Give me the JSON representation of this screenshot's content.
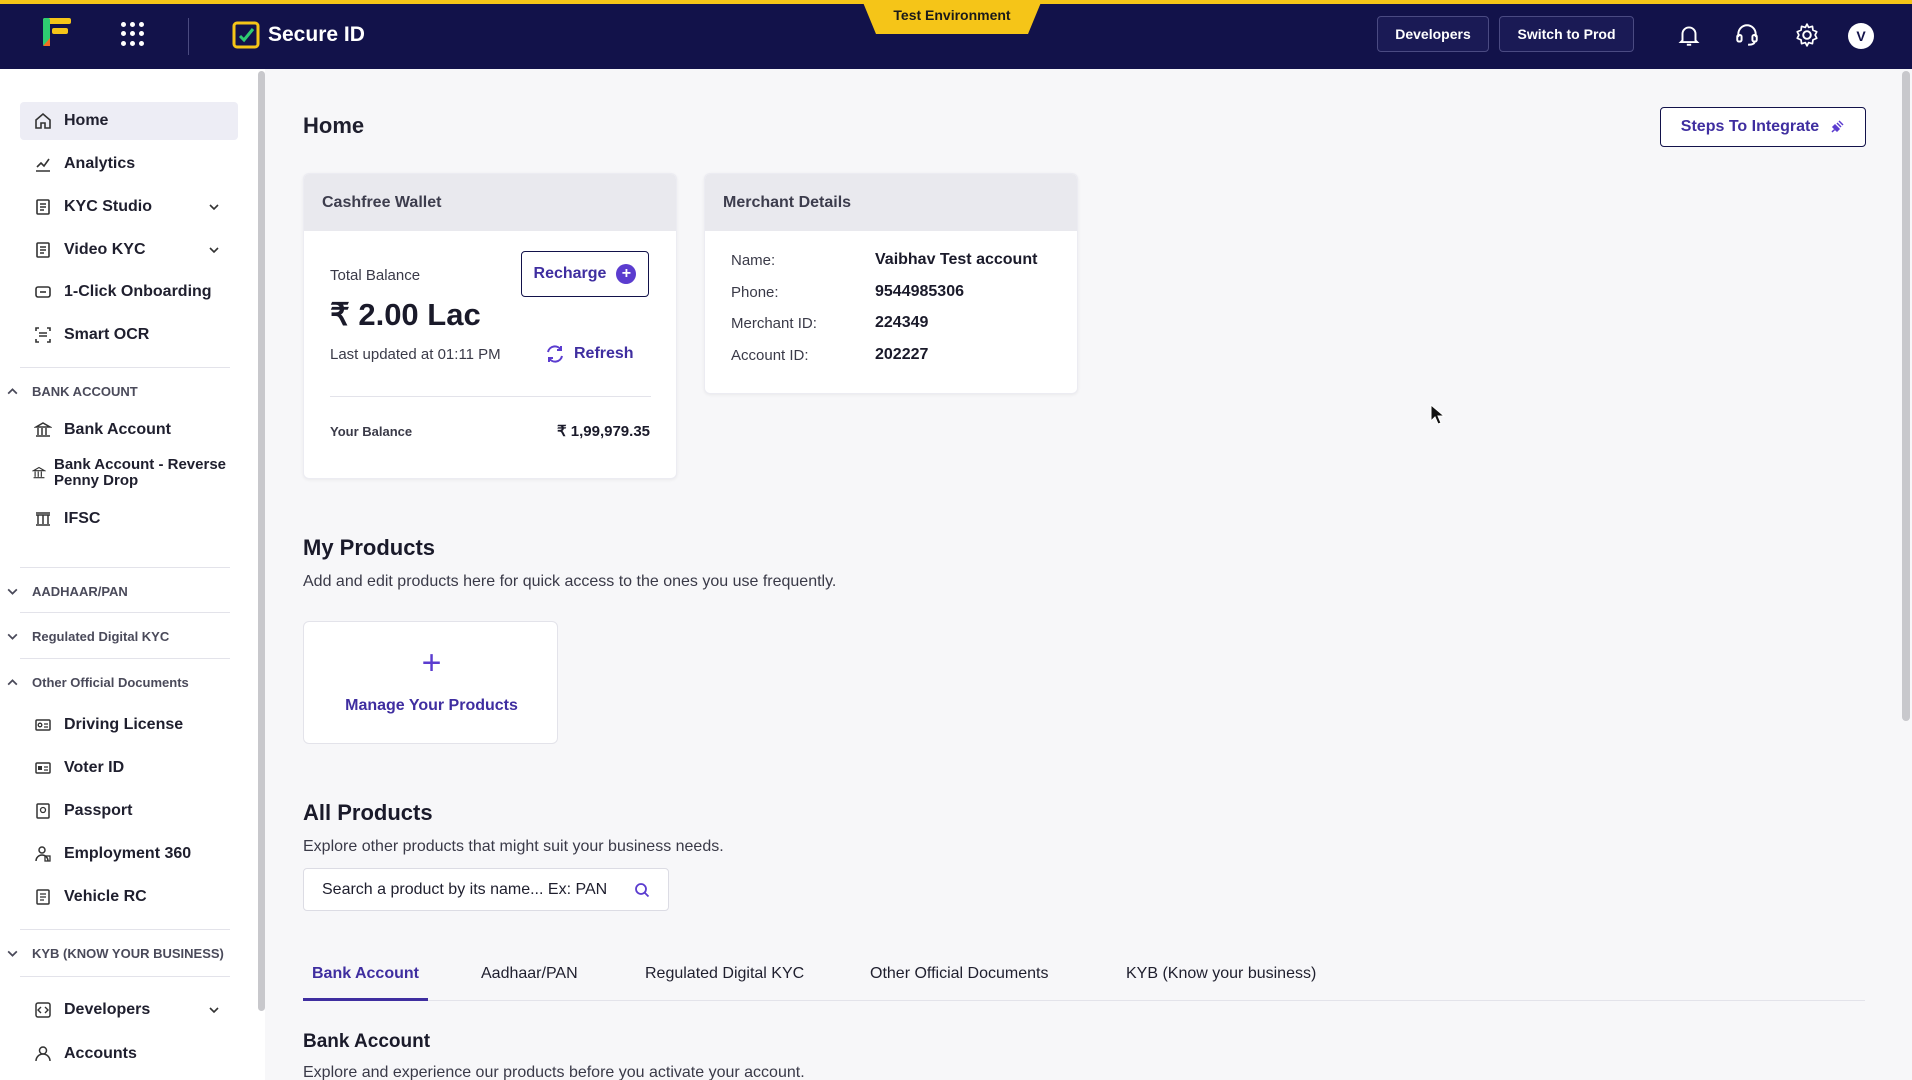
{
  "topbar": {
    "brand": "Secure ID",
    "environment": "Test Environment",
    "developers_label": "Developers",
    "switch_label": "Switch to Prod",
    "avatar_initial": "V",
    "colors": {
      "background": "#12124a",
      "accent": "#f5c518"
    }
  },
  "sidebar": {
    "items": [
      {
        "label": "Home",
        "icon": "home-icon",
        "active": true
      },
      {
        "label": "Analytics",
        "icon": "analytics-icon"
      },
      {
        "label": "KYC Studio",
        "icon": "kyc-studio-icon",
        "expandable": true
      },
      {
        "label": "Video KYC",
        "icon": "video-kyc-icon",
        "expandable": true
      },
      {
        "label": "1-Click Onboarding",
        "icon": "onboarding-icon"
      },
      {
        "label": "Smart OCR",
        "icon": "ocr-icon"
      }
    ],
    "sections": {
      "bank_account": {
        "title": "BANK ACCOUNT",
        "items": [
          "Bank Account",
          "Bank Account - Reverse Penny Drop",
          "IFSC"
        ]
      },
      "aadhaar_pan": {
        "title": "AADHAAR/PAN"
      },
      "regulated_kyc": {
        "title": "Regulated Digital KYC"
      },
      "other_docs": {
        "title": "Other Official Documents",
        "items": [
          "Driving License",
          "Voter ID",
          "Passport",
          "Employment 360",
          "Vehicle RC"
        ]
      },
      "kyb": {
        "title": "KYB (KNOW YOUR BUSINESS)"
      }
    },
    "bottom": [
      {
        "label": "Developers",
        "expandable": true
      },
      {
        "label": "Accounts"
      }
    ]
  },
  "main": {
    "title": "Home",
    "steps_label": "Steps To Integrate",
    "wallet": {
      "title": "Cashfree Wallet",
      "total_label": "Total Balance",
      "total_amount": "₹ 2.00 Lac",
      "recharge_label": "Recharge",
      "updated_text": "Last updated at 01:11 PM",
      "refresh_label": "Refresh",
      "your_balance_label": "Your Balance",
      "your_balance_value": "₹ 1,99,979.35"
    },
    "merchant": {
      "title": "Merchant Details",
      "rows": [
        {
          "label": "Name:",
          "value": "Vaibhav Test account"
        },
        {
          "label": "Phone:",
          "value": "9544985306"
        },
        {
          "label": "Merchant ID:",
          "value": "224349"
        },
        {
          "label": "Account ID:",
          "value": "202227"
        }
      ]
    },
    "my_products": {
      "title": "My Products",
      "subtitle": "Add and edit products here for quick access to the ones you use frequently.",
      "manage_label": "Manage Your Products"
    },
    "all_products": {
      "title": "All Products",
      "subtitle": "Explore other products that might suit your business needs.",
      "search_placeholder": "Search a product by its name... Ex: PAN",
      "tabs": [
        "Bank Account",
        "Aadhaar/PAN",
        "Regulated Digital KYC",
        "Other Official Documents",
        "KYB (Know your business)"
      ],
      "active_tab": "Bank Account",
      "section_title": "Bank Account",
      "section_subtitle": "Explore and experience our products before you activate your account."
    }
  }
}
